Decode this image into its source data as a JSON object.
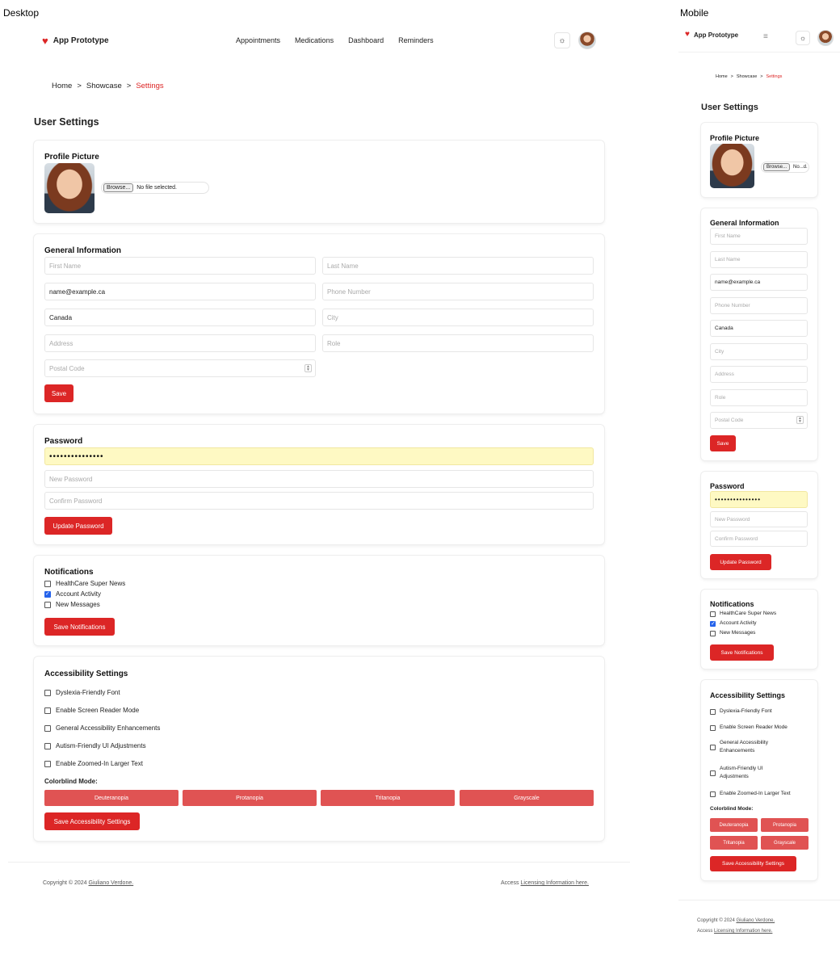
{
  "labels": {
    "desktop": "Desktop",
    "mobile": "Mobile"
  },
  "brand": {
    "name": "App Prototype",
    "icon": "heart-icon",
    "accent": "#dc2626"
  },
  "nav": {
    "links": [
      "Appointments",
      "Medications",
      "Dashboard",
      "Reminders"
    ],
    "theme_icon": "sun-icon",
    "menu_icon": "hamburger-icon"
  },
  "breadcrumb": {
    "home": "Home",
    "sep": ">",
    "showcase": "Showcase",
    "current": "Settings"
  },
  "page_title": "User Settings",
  "profile": {
    "heading": "Profile Picture",
    "browse": "Browse...",
    "no_file": "No file selected.",
    "no_file_short": "No...d."
  },
  "general": {
    "heading": "General Information",
    "first_name": "First Name",
    "last_name": "Last Name",
    "email": "name@example.ca",
    "phone": "Phone Number",
    "country": "Canada",
    "city": "City",
    "address": "Address",
    "role": "Role",
    "postal": "Postal Code",
    "save": "Save"
  },
  "password": {
    "heading": "Password",
    "current": "•••••••••••••••",
    "new": "New Password",
    "confirm": "Confirm Password",
    "update": "Update Password"
  },
  "notifications": {
    "heading": "Notifications",
    "items": [
      {
        "label": "HealthCare Super News",
        "checked": false
      },
      {
        "label": "Account Activity",
        "checked": true
      },
      {
        "label": "New Messages",
        "checked": false
      }
    ],
    "save": "Save Notifications"
  },
  "accessibility": {
    "heading": "Accessibility Settings",
    "items": [
      "Dyslexia-Friendly Font",
      "Enable Screen Reader Mode",
      "General Accessibility Enhancements",
      "Autism-Friendly UI Adjustments",
      "Enable Zoomed-In Larger Text"
    ],
    "mobile_items": [
      "Dyslexia-Friendly Font",
      "Enable Screen Reader Mode",
      "General Accessibility",
      "Enhancements",
      "Autism-Friendly UI",
      "Adjustments",
      "Enable Zoomed-In Larger Text"
    ],
    "colorblind_label": "Colorblind Mode:",
    "modes": [
      "Deuteranopia",
      "Protanopia",
      "Tritanopia",
      "Grayscale"
    ],
    "save": "Save Accessibility Settings"
  },
  "footer": {
    "copyright": "Copyright © 2024",
    "author": "Giuliano Verdone.",
    "access": "Access",
    "licensing": "Licensing Information here."
  }
}
